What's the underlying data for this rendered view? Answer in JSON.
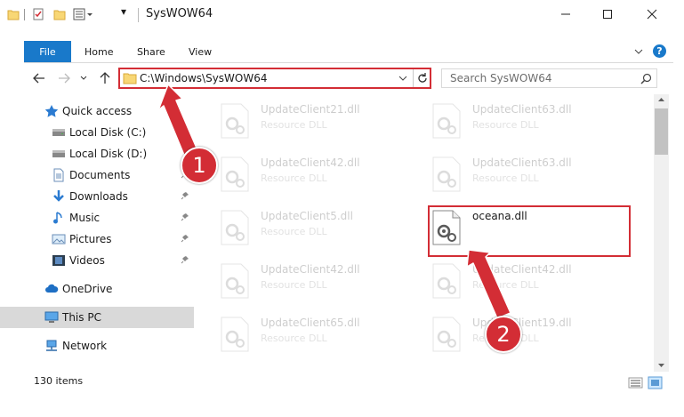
{
  "window": {
    "title": "SysWOW64",
    "controls": [
      "minimize",
      "maximize",
      "close"
    ]
  },
  "ribbon": {
    "tabs": [
      "File",
      "Home",
      "Share",
      "View"
    ],
    "help_glyph": "?"
  },
  "address": {
    "path": "C:\\Windows\\SysWOW64",
    "search_placeholder": "Search SysWOW64"
  },
  "nav_pane": {
    "items": [
      {
        "label": "Quick access",
        "icon": "star-icon",
        "pinned": false
      },
      {
        "label": "Local Disk (C:)",
        "icon": "drive-icon",
        "pinned": false
      },
      {
        "label": "Local Disk (D:)",
        "icon": "drive-icon",
        "pinned": false
      },
      {
        "label": "Documents",
        "icon": "documents-icon",
        "pinned": true
      },
      {
        "label": "Downloads",
        "icon": "download-icon",
        "pinned": true
      },
      {
        "label": "Music",
        "icon": "music-icon",
        "pinned": true
      },
      {
        "label": "Pictures",
        "icon": "pictures-icon",
        "pinned": true
      },
      {
        "label": "Videos",
        "icon": "videos-icon",
        "pinned": true
      },
      {
        "label": "OneDrive",
        "icon": "cloud-icon",
        "pinned": false
      },
      {
        "label": "This PC",
        "icon": "computer-icon",
        "pinned": false,
        "selected": true
      },
      {
        "label": "Network",
        "icon": "network-icon",
        "pinned": false
      }
    ]
  },
  "files": [
    {
      "name": "UpdateClient21.dll",
      "type": "Resource DLL",
      "faded": true
    },
    {
      "name": "UpdateClient63.dll",
      "type": "Resource DLL",
      "faded": true
    },
    {
      "name": "UpdateClient42.dll",
      "type": "Resource DLL",
      "faded": true
    },
    {
      "name": "UpdateClient63.dll",
      "type": "Resource DLL",
      "faded": true
    },
    {
      "name": "UpdateClient5.dll",
      "type": "Resource DLL",
      "faded": true
    },
    {
      "name": "oceana.dll",
      "type": "",
      "faded": false
    },
    {
      "name": "UpdateClient42.dll",
      "type": "Resource DLL",
      "faded": true
    },
    {
      "name": "UpdateClient42.dll",
      "type": "Resource DLL",
      "faded": true
    },
    {
      "name": "UpdateClient65.dll",
      "type": "Resource DLL",
      "faded": true
    },
    {
      "name": "UpdateClient19.dll",
      "type": "Resource DLL",
      "faded": true
    }
  ],
  "status_bar": {
    "item_count": "130 items"
  },
  "annotations": {
    "step1": "1",
    "step2": "2",
    "color": "#d32d35"
  },
  "colors": {
    "accent": "#1979ca",
    "highlight": "#d32d35",
    "selected_nav": "#d9d9d9"
  }
}
